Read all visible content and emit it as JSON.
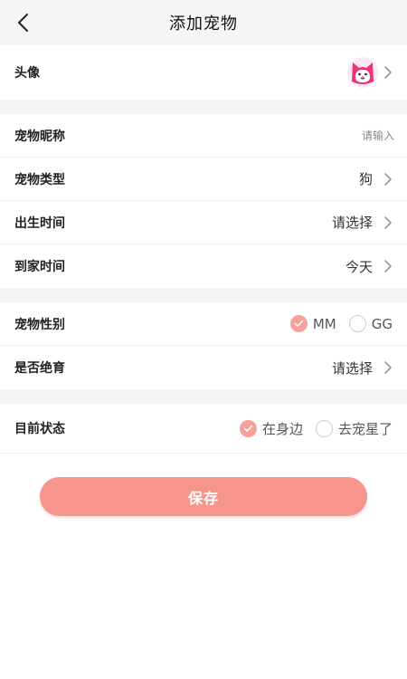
{
  "header": {
    "title": "添加宠物",
    "back_icon": "chevron-left-icon"
  },
  "avatar_row": {
    "label": "头像",
    "avatar_icon": "cat-face-icon"
  },
  "form": {
    "nickname": {
      "label": "宠物昵称",
      "placeholder": "请输入",
      "value": ""
    },
    "type": {
      "label": "宠物类型",
      "value": "狗"
    },
    "birth": {
      "label": "出生时间",
      "value": "请选择"
    },
    "arrival": {
      "label": "到家时间",
      "value": "今天"
    },
    "gender": {
      "label": "宠物性别",
      "options": [
        {
          "label": "MM",
          "checked": true
        },
        {
          "label": "GG",
          "checked": false
        }
      ]
    },
    "neutered": {
      "label": "是否绝育",
      "value": "请选择"
    },
    "status": {
      "label": "目前状态",
      "options": [
        {
          "label": "在身边",
          "checked": true
        },
        {
          "label": "去宠星了",
          "checked": false
        }
      ]
    }
  },
  "save_label": "保存",
  "colors": {
    "accent": "#f6958c",
    "radio_checked": "#f6a099",
    "avatar_pink": "#e8357a",
    "section_gap": "#f5f5f5"
  }
}
